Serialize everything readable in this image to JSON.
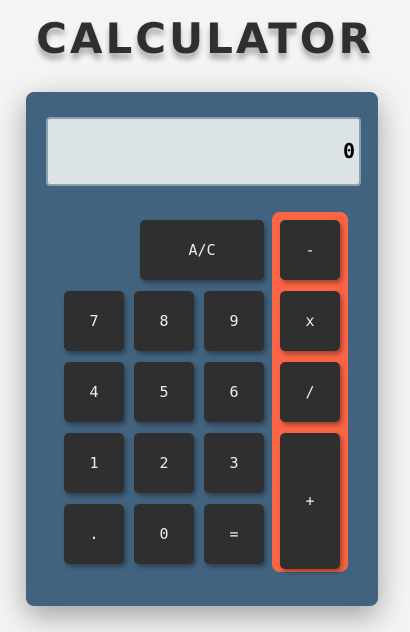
{
  "title": "CALCULATOR",
  "display": {
    "value": "0"
  },
  "buttons": {
    "clear": "A/C",
    "minus": "-",
    "times": "x",
    "divide": "/",
    "plus": "+",
    "seven": "7",
    "eight": "8",
    "nine": "9",
    "four": "4",
    "five": "5",
    "six": "6",
    "one": "1",
    "two": "2",
    "three": "3",
    "dot": ".",
    "zero": "0",
    "equals": "="
  },
  "colors": {
    "panel": "#42637f",
    "operators": "#fb6444",
    "button": "#2f2f2f",
    "display": "#dce3e6"
  }
}
